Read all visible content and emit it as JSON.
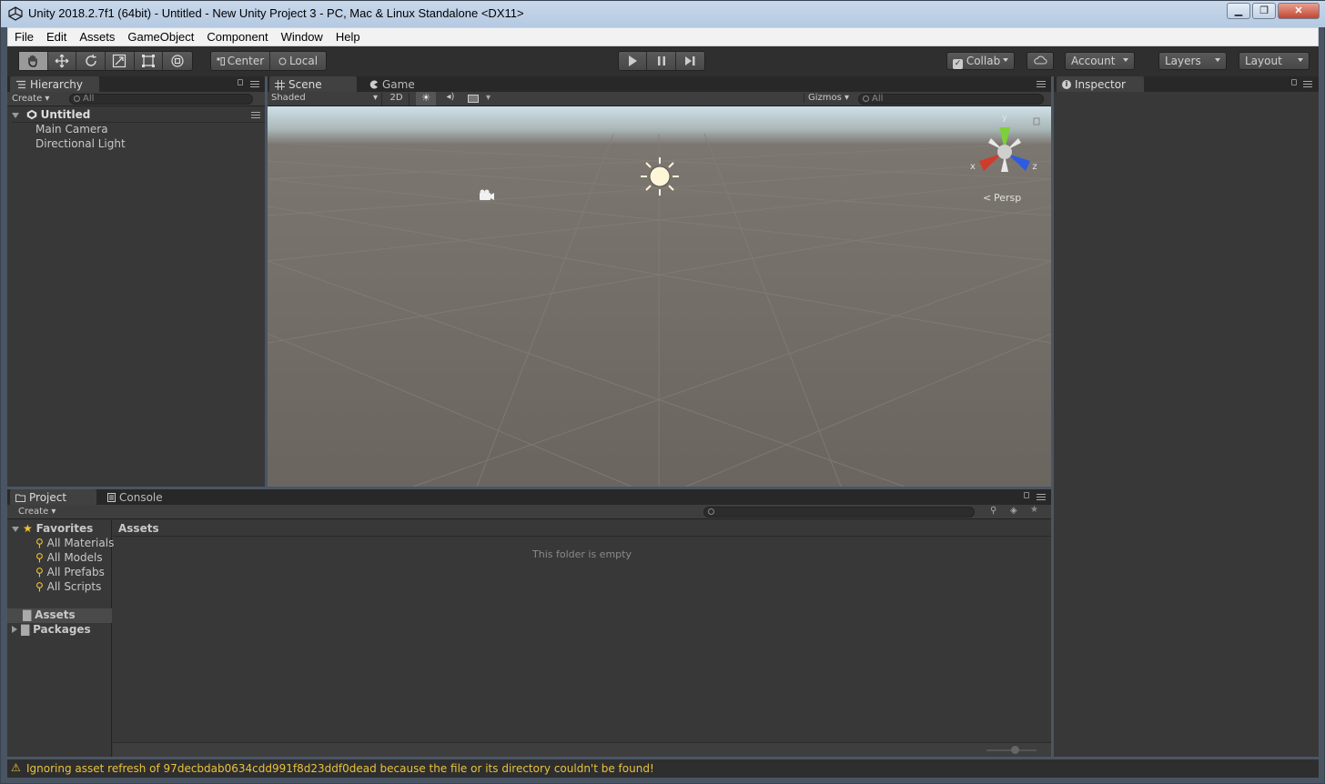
{
  "window": {
    "title": "Unity 2018.2.7f1 (64bit) - Untitled - New Unity Project 3 - PC, Mac & Linux Standalone <DX11>",
    "minimize": "▁",
    "restore": "❐",
    "close": "✕"
  },
  "menu": [
    "File",
    "Edit",
    "Assets",
    "GameObject",
    "Component",
    "Window",
    "Help"
  ],
  "toolbar": {
    "pivot_center": "Center",
    "pivot_local": "Local",
    "collab": "Collab",
    "account": "Account",
    "layers": "Layers",
    "layout": "Layout"
  },
  "hierarchy": {
    "tab": "Hierarchy",
    "create": "Create",
    "search_placeholder": "All",
    "scene": "Untitled",
    "items": [
      "Main Camera",
      "Directional Light"
    ]
  },
  "scene_view": {
    "tab_scene": "Scene",
    "tab_game": "Game",
    "shading": "Shaded",
    "mode_2d": "2D",
    "gizmos": "Gizmos",
    "search_placeholder": "All",
    "persp": "Persp",
    "axis_x": "x",
    "axis_y": "y",
    "axis_z": "z"
  },
  "inspector": {
    "tab": "Inspector"
  },
  "project": {
    "tab_project": "Project",
    "tab_console": "Console",
    "create": "Create",
    "favorites": "Favorites",
    "favorite_items": [
      "All Materials",
      "All Models",
      "All Prefabs",
      "All Scripts"
    ],
    "folders": [
      "Assets",
      "Packages"
    ],
    "breadcrumb": "Assets",
    "empty_message": "This folder is empty"
  },
  "status": {
    "message": "Ignoring asset refresh of 97decbdab0634cdd991f8d23ddf0dead because the file or its directory couldn't be found!"
  },
  "colors": {
    "warning": "#e8c23c",
    "axis_x": "#d23a2a",
    "axis_y": "#7ed03a",
    "axis_z": "#2f5be0"
  }
}
